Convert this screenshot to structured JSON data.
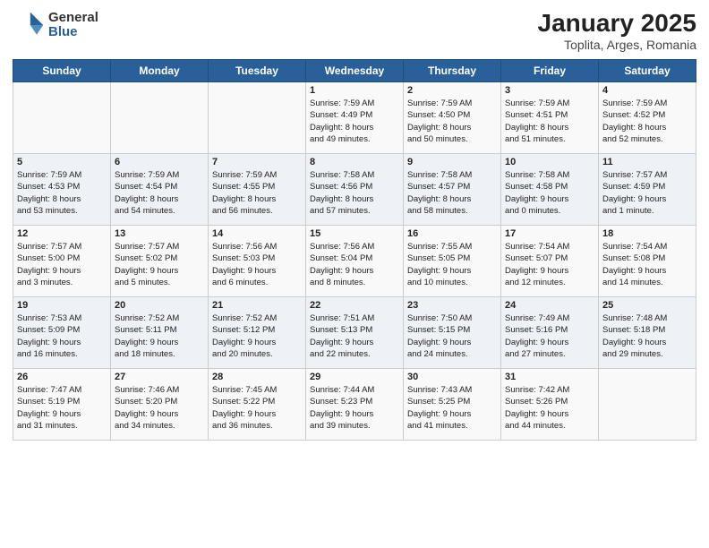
{
  "logo": {
    "general": "General",
    "blue": "Blue"
  },
  "title": "January 2025",
  "subtitle": "Toplita, Arges, Romania",
  "days_of_week": [
    "Sunday",
    "Monday",
    "Tuesday",
    "Wednesday",
    "Thursday",
    "Friday",
    "Saturday"
  ],
  "weeks": [
    [
      {
        "day": "",
        "info": ""
      },
      {
        "day": "",
        "info": ""
      },
      {
        "day": "",
        "info": ""
      },
      {
        "day": "1",
        "info": "Sunrise: 7:59 AM\nSunset: 4:49 PM\nDaylight: 8 hours\nand 49 minutes."
      },
      {
        "day": "2",
        "info": "Sunrise: 7:59 AM\nSunset: 4:50 PM\nDaylight: 8 hours\nand 50 minutes."
      },
      {
        "day": "3",
        "info": "Sunrise: 7:59 AM\nSunset: 4:51 PM\nDaylight: 8 hours\nand 51 minutes."
      },
      {
        "day": "4",
        "info": "Sunrise: 7:59 AM\nSunset: 4:52 PM\nDaylight: 8 hours\nand 52 minutes."
      }
    ],
    [
      {
        "day": "5",
        "info": "Sunrise: 7:59 AM\nSunset: 4:53 PM\nDaylight: 8 hours\nand 53 minutes."
      },
      {
        "day": "6",
        "info": "Sunrise: 7:59 AM\nSunset: 4:54 PM\nDaylight: 8 hours\nand 54 minutes."
      },
      {
        "day": "7",
        "info": "Sunrise: 7:59 AM\nSunset: 4:55 PM\nDaylight: 8 hours\nand 56 minutes."
      },
      {
        "day": "8",
        "info": "Sunrise: 7:58 AM\nSunset: 4:56 PM\nDaylight: 8 hours\nand 57 minutes."
      },
      {
        "day": "9",
        "info": "Sunrise: 7:58 AM\nSunset: 4:57 PM\nDaylight: 8 hours\nand 58 minutes."
      },
      {
        "day": "10",
        "info": "Sunrise: 7:58 AM\nSunset: 4:58 PM\nDaylight: 9 hours\nand 0 minutes."
      },
      {
        "day": "11",
        "info": "Sunrise: 7:57 AM\nSunset: 4:59 PM\nDaylight: 9 hours\nand 1 minute."
      }
    ],
    [
      {
        "day": "12",
        "info": "Sunrise: 7:57 AM\nSunset: 5:00 PM\nDaylight: 9 hours\nand 3 minutes."
      },
      {
        "day": "13",
        "info": "Sunrise: 7:57 AM\nSunset: 5:02 PM\nDaylight: 9 hours\nand 5 minutes."
      },
      {
        "day": "14",
        "info": "Sunrise: 7:56 AM\nSunset: 5:03 PM\nDaylight: 9 hours\nand 6 minutes."
      },
      {
        "day": "15",
        "info": "Sunrise: 7:56 AM\nSunset: 5:04 PM\nDaylight: 9 hours\nand 8 minutes."
      },
      {
        "day": "16",
        "info": "Sunrise: 7:55 AM\nSunset: 5:05 PM\nDaylight: 9 hours\nand 10 minutes."
      },
      {
        "day": "17",
        "info": "Sunrise: 7:54 AM\nSunset: 5:07 PM\nDaylight: 9 hours\nand 12 minutes."
      },
      {
        "day": "18",
        "info": "Sunrise: 7:54 AM\nSunset: 5:08 PM\nDaylight: 9 hours\nand 14 minutes."
      }
    ],
    [
      {
        "day": "19",
        "info": "Sunrise: 7:53 AM\nSunset: 5:09 PM\nDaylight: 9 hours\nand 16 minutes."
      },
      {
        "day": "20",
        "info": "Sunrise: 7:52 AM\nSunset: 5:11 PM\nDaylight: 9 hours\nand 18 minutes."
      },
      {
        "day": "21",
        "info": "Sunrise: 7:52 AM\nSunset: 5:12 PM\nDaylight: 9 hours\nand 20 minutes."
      },
      {
        "day": "22",
        "info": "Sunrise: 7:51 AM\nSunset: 5:13 PM\nDaylight: 9 hours\nand 22 minutes."
      },
      {
        "day": "23",
        "info": "Sunrise: 7:50 AM\nSunset: 5:15 PM\nDaylight: 9 hours\nand 24 minutes."
      },
      {
        "day": "24",
        "info": "Sunrise: 7:49 AM\nSunset: 5:16 PM\nDaylight: 9 hours\nand 27 minutes."
      },
      {
        "day": "25",
        "info": "Sunrise: 7:48 AM\nSunset: 5:18 PM\nDaylight: 9 hours\nand 29 minutes."
      }
    ],
    [
      {
        "day": "26",
        "info": "Sunrise: 7:47 AM\nSunset: 5:19 PM\nDaylight: 9 hours\nand 31 minutes."
      },
      {
        "day": "27",
        "info": "Sunrise: 7:46 AM\nSunset: 5:20 PM\nDaylight: 9 hours\nand 34 minutes."
      },
      {
        "day": "28",
        "info": "Sunrise: 7:45 AM\nSunset: 5:22 PM\nDaylight: 9 hours\nand 36 minutes."
      },
      {
        "day": "29",
        "info": "Sunrise: 7:44 AM\nSunset: 5:23 PM\nDaylight: 9 hours\nand 39 minutes."
      },
      {
        "day": "30",
        "info": "Sunrise: 7:43 AM\nSunset: 5:25 PM\nDaylight: 9 hours\nand 41 minutes."
      },
      {
        "day": "31",
        "info": "Sunrise: 7:42 AM\nSunset: 5:26 PM\nDaylight: 9 hours\nand 44 minutes."
      },
      {
        "day": "",
        "info": ""
      }
    ]
  ]
}
